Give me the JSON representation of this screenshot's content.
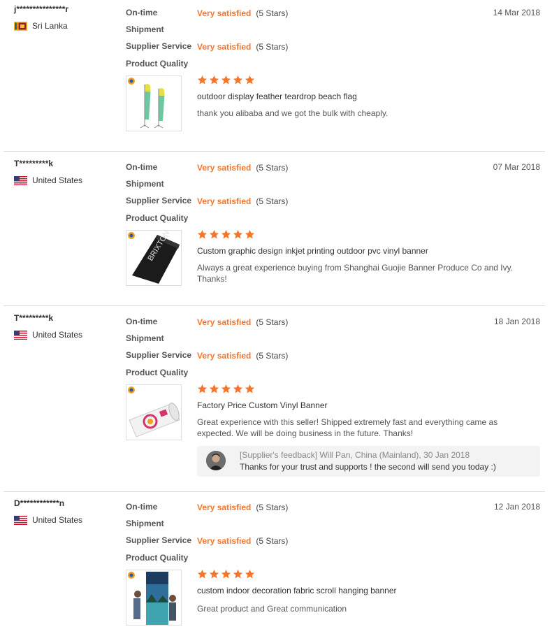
{
  "labels": {
    "on_time": "On-time",
    "shipment": "Shipment",
    "supplier_service": "Supplier Service",
    "product_quality": "Product Quality"
  },
  "colors": {
    "accent": "#f4762b",
    "divider": "#dcdcdc",
    "feedback_bg": "#f3f3f3"
  },
  "reviews": [
    {
      "buyer": "j***************r",
      "country": "Sri Lanka",
      "flag_icon": "sri-lanka-flag-icon",
      "date": "14 Mar 2018",
      "shipment_rating": "Very satisfied",
      "shipment_stars": "(5 Stars)",
      "service_rating": "Very satisfied",
      "service_stars": "(5 Stars)",
      "quality_stars": 5,
      "product": "outdoor display feather teardrop beach flag",
      "comment": "thank you alibaba and we got the bulk with cheaply."
    },
    {
      "buyer": "T*********k",
      "country": "United States",
      "flag_icon": "us-flag-icon",
      "date": "07 Mar 2018",
      "shipment_rating": "Very satisfied",
      "shipment_stars": "(5 Stars)",
      "service_rating": "Very satisfied",
      "service_stars": "(5 Stars)",
      "quality_stars": 5,
      "product": "Custom graphic design inkjet printing outdoor pvc vinyl banner",
      "comment": "Always a great experience buying from Shanghai Guojie Banner Produce Co and Ivy. Thanks!"
    },
    {
      "buyer": "T*********k",
      "country": "United States",
      "flag_icon": "us-flag-icon",
      "date": "18 Jan 2018",
      "shipment_rating": "Very satisfied",
      "shipment_stars": "(5 Stars)",
      "service_rating": "Very satisfied",
      "service_stars": "(5 Stars)",
      "quality_stars": 5,
      "product": "Factory Price Custom Vinyl Banner",
      "comment": "Great experience with this seller! Shipped extremely fast and everything came as expected. We will be doing business in the future. Thanks!",
      "feedback": {
        "header": "[Supplier's feedback] Will Pan, China (Mainland), 30 Jan 2018",
        "text": "Thanks for your trust and supports ! the second will send you today :)"
      }
    },
    {
      "buyer": "D************n",
      "country": "United States",
      "flag_icon": "us-flag-icon",
      "date": "12 Jan 2018",
      "shipment_rating": "Very satisfied",
      "shipment_stars": "(5 Stars)",
      "service_rating": "Very satisfied",
      "service_stars": "(5 Stars)",
      "quality_stars": 5,
      "product": "custom indoor decoration fabric scroll hanging banner",
      "comment": "Great product and Great communication"
    }
  ]
}
